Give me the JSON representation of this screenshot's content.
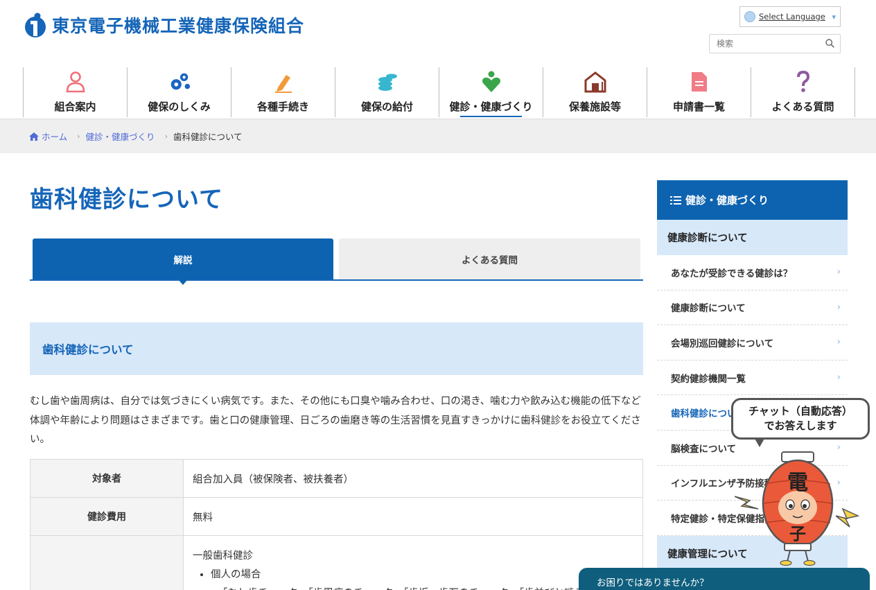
{
  "header": {
    "logo_text": "東京電子機械工業健康保険組合",
    "language_label": "Select Language",
    "search_placeholder": "検索"
  },
  "nav": [
    {
      "label": "組合案内",
      "icon": "person-icon"
    },
    {
      "label": "健保のしくみ",
      "icon": "gears-icon"
    },
    {
      "label": "各種手続き",
      "icon": "pen-icon"
    },
    {
      "label": "健保の給付",
      "icon": "coins-icon"
    },
    {
      "label": "健診・健康づくり",
      "icon": "heart-person-icon",
      "active": true
    },
    {
      "label": "保養施設等",
      "icon": "house-icon"
    },
    {
      "label": "申請書一覧",
      "icon": "document-icon"
    },
    {
      "label": "よくある質問",
      "icon": "question-icon"
    }
  ],
  "breadcrumb": {
    "home": "ホーム",
    "parent": "健診・健康づくり",
    "current": "歯科健診について"
  },
  "page": {
    "title": "歯科健診について",
    "tabs": [
      "解説",
      "よくある質問"
    ],
    "section_heading": "歯科健診について",
    "intro": "むし歯や歯周病は、自分では気づきにくい病気です。また、その他にも口臭や噛み合わせ、口の渇き、噛む力や飲み込む機能の低下など体調や年齢により問題はさまざまです。歯と口の健康管理、日ごろの歯磨き等の生活習慣を見直すきっかけに歯科健診をお役立てください。",
    "table": {
      "row1_label": "対象者",
      "row1_value": "組合加入員（被保険者、被扶養者）",
      "row2_label": "健診費用",
      "row2_value": "無料",
      "row3_title": "一般歯科健診",
      "row3_bullet": "個人の場合",
      "row3_partial": "「むし歯チェック」「歯周病のチェック」「歯垢・歯石のチェック」「歯並びと噛み"
    }
  },
  "sidebar": {
    "heading": "健診・健康づくり",
    "group1": "健康診断について",
    "items": [
      "あなたが受診できる健診は？",
      "健康診断について",
      "会場別巡回健診について",
      "契約健診機関一覧",
      "歯科健診について",
      "脳検査について",
      "インフルエンザ予防接種",
      "特定健診・特定保健指導"
    ],
    "group2": "健康管理について"
  },
  "chat": {
    "line1": "チャット（自動応答）",
    "line2": "でお答えします",
    "mascot_char_top": "電",
    "mascot_char_bottom": "子",
    "help": "お困りではありませんか？"
  },
  "colors": {
    "brand_blue": "#1565b8",
    "tab_active": "#0d63b0",
    "light_blue": "#d7e8f9",
    "help_bar": "#0f5e7d"
  }
}
